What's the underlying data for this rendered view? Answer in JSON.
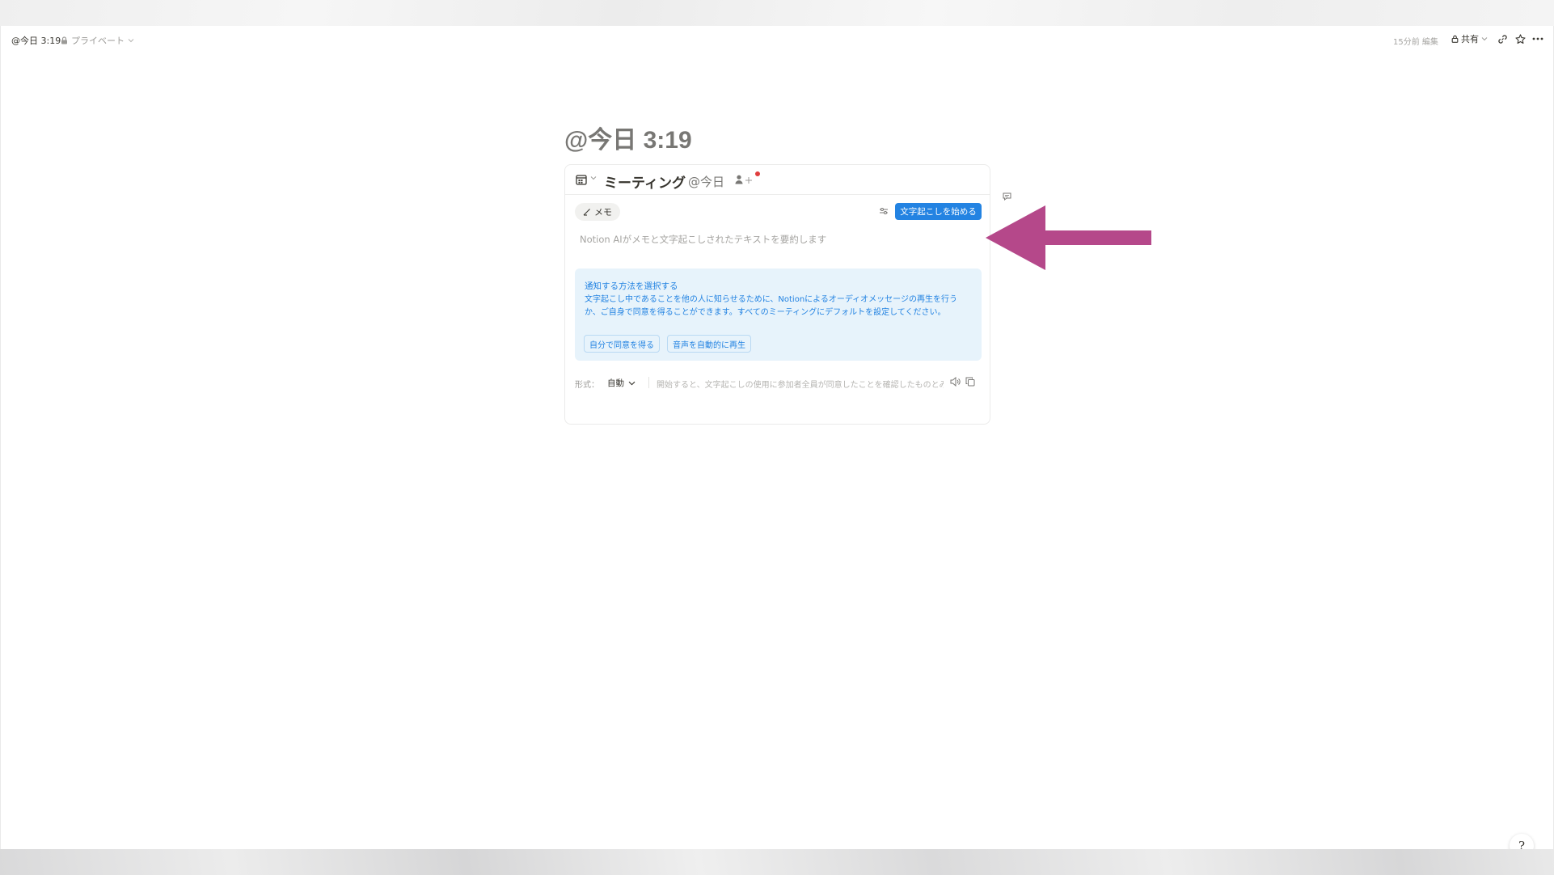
{
  "topbar": {
    "page_title": "@今日 3:19",
    "privacy_label": "プライベート",
    "edited_label": "15分前 編集",
    "share_label": "共有"
  },
  "page": {
    "title": "@今日 3:19"
  },
  "meeting_card": {
    "title": "ミーティング",
    "date": "@今日",
    "memo_tab": "メモ",
    "start_button": "文字起こしを始める",
    "summary_placeholder": "Notion AIがメモと文字起こしされたテキストを要約します",
    "notify": {
      "title": "通知する方法を選択する",
      "body": "文字起こし中であることを他の人に知らせるために、Notionによるオーディオメッセージの再生を行うか、ご自身で同意を得ることができます。すべてのミーティングにデフォルトを設定してください。",
      "self_consent_button": "自分で同意を得る",
      "auto_play_button": "音声を自動的に再生"
    },
    "footer": {
      "format_label": "形式：",
      "format_value": "自動",
      "consent_note": "開始すると、文字起こしの使用に参加者全員が同意したことを確認したものとみなされます"
    }
  },
  "help_button": "?",
  "colors": {
    "accent": "#2383e2",
    "annotation_arrow": "#b5488a",
    "notify_bg": "#e7f3fb"
  }
}
